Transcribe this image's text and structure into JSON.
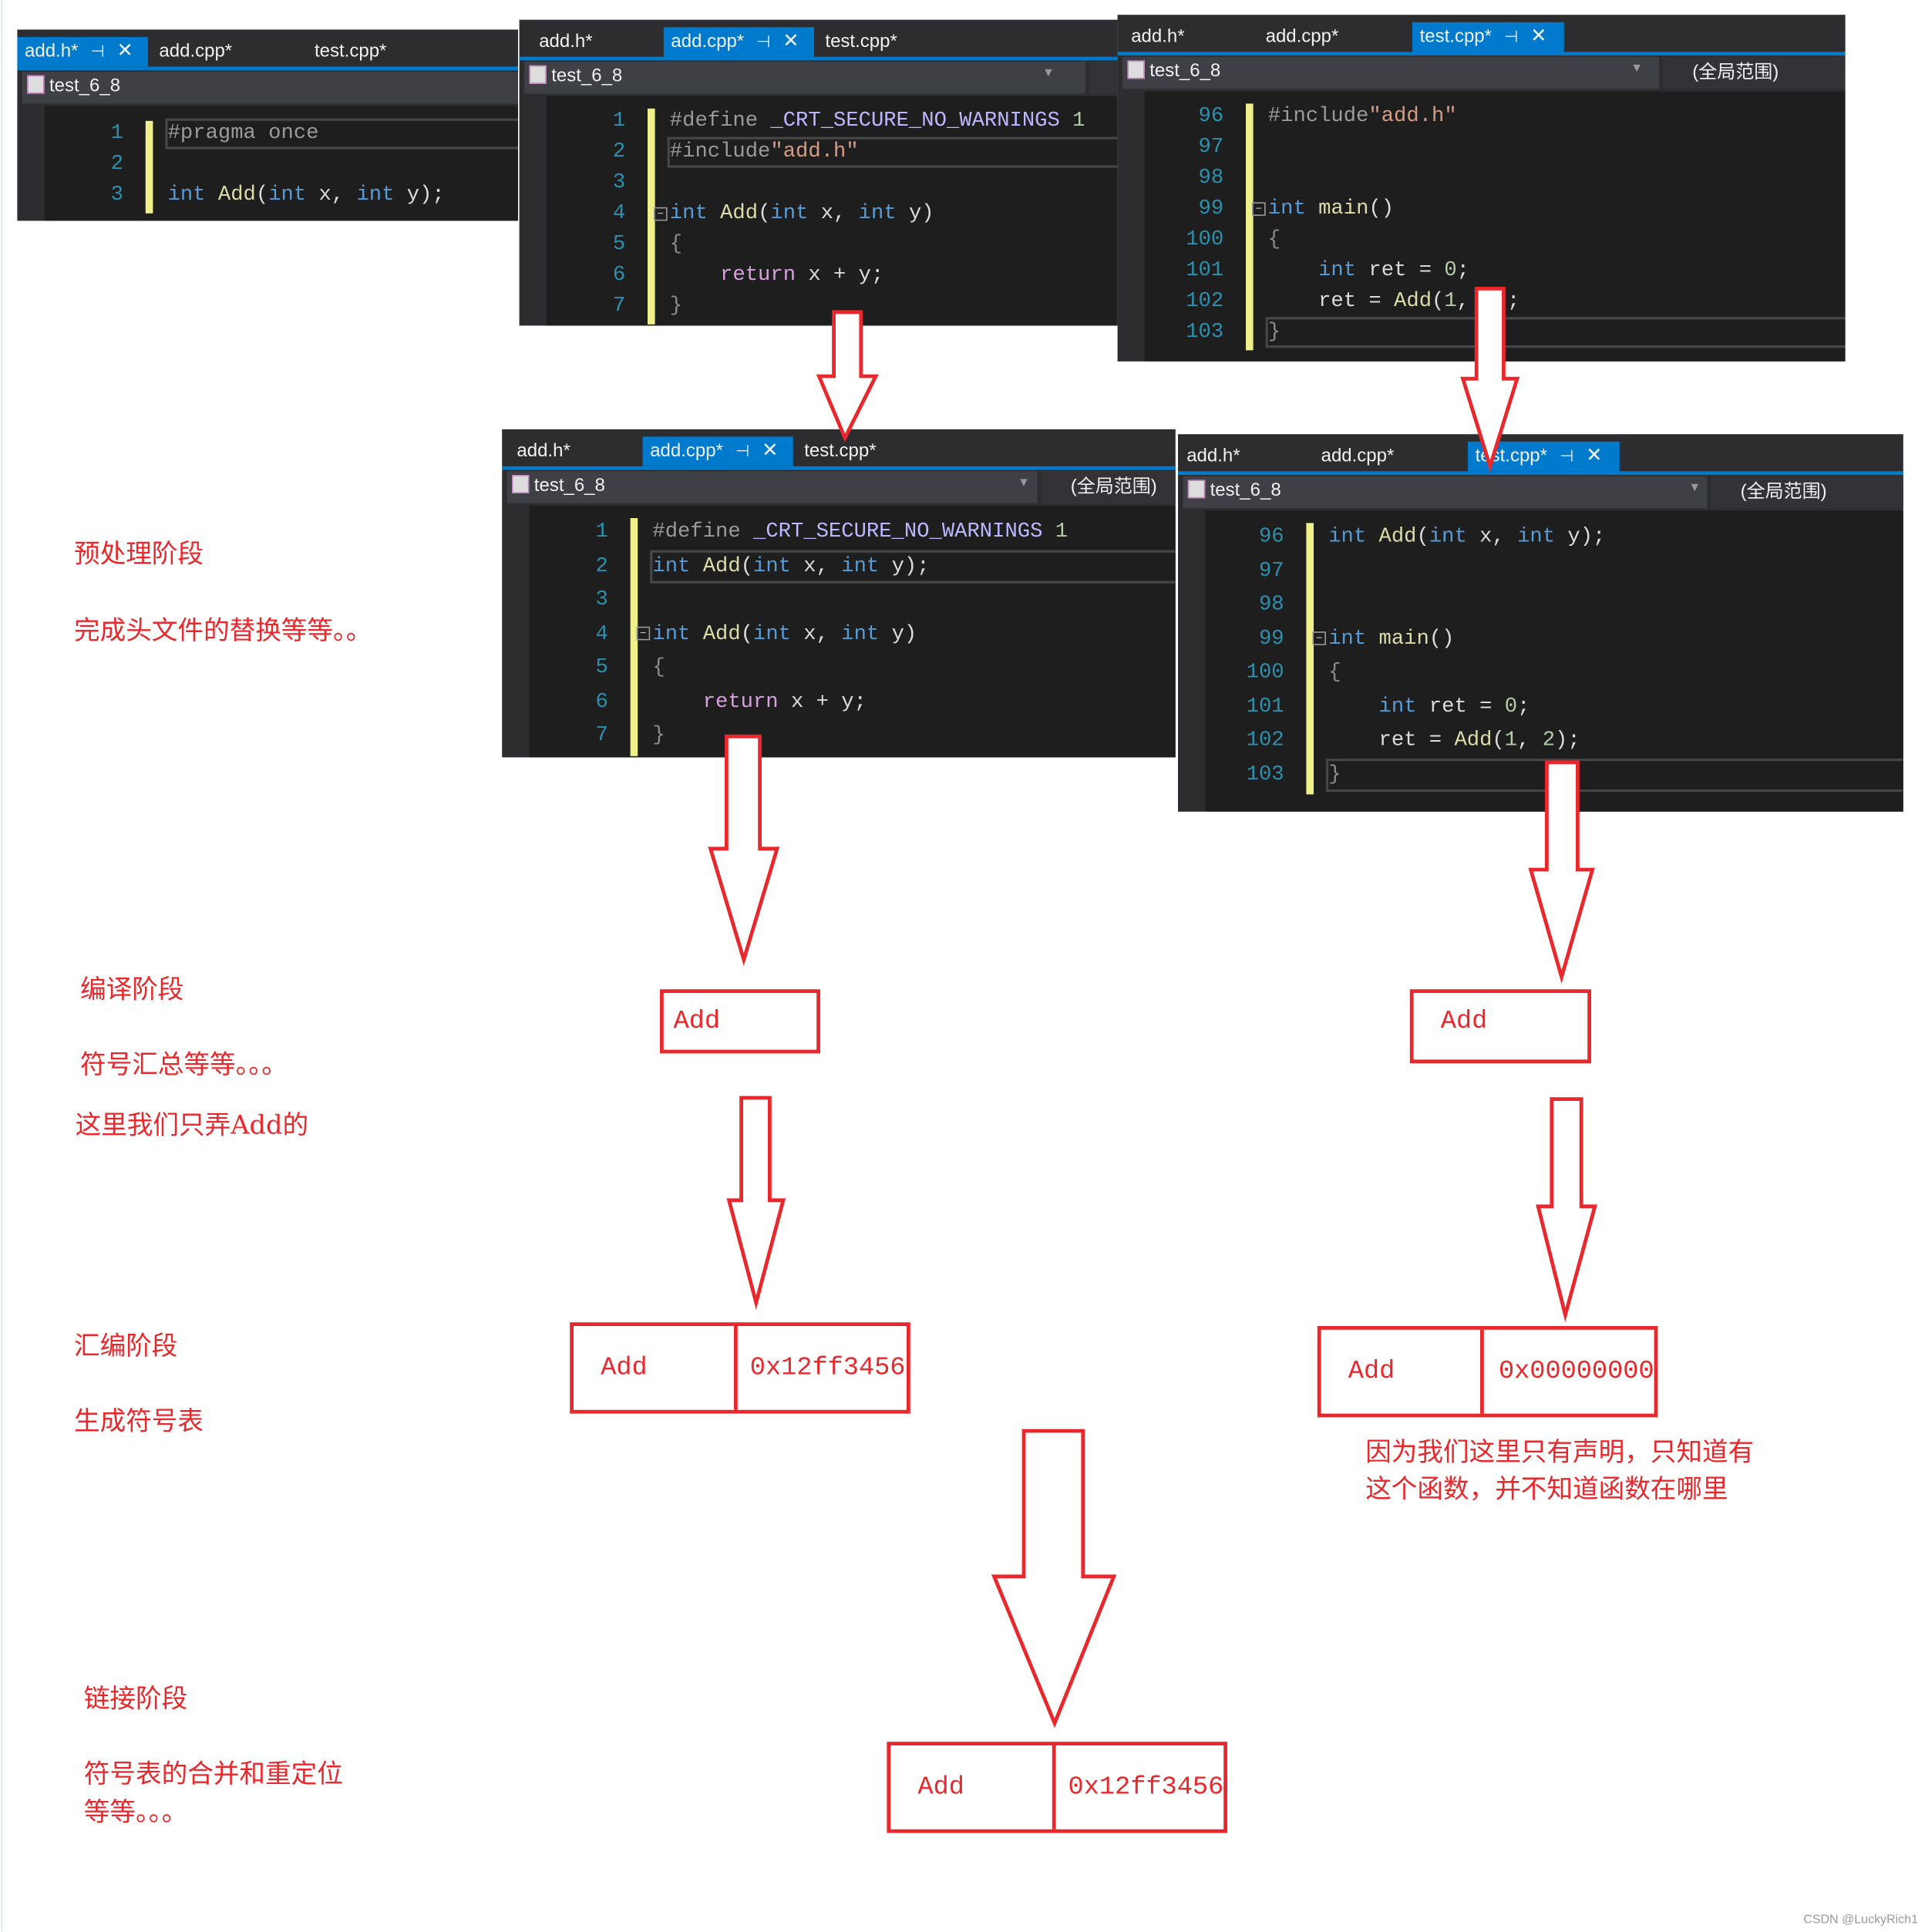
{
  "colors": {
    "accent": "#e8282c",
    "tab_active": "#007acc",
    "guide": "#eff08a"
  },
  "editors": [
    {
      "id": "p1",
      "tabs": [
        {
          "label": "add.h*",
          "active": true
        },
        {
          "label": "add.cpp*"
        },
        {
          "label": "test.cpp*"
        }
      ],
      "project": "test_6_8",
      "scope": "",
      "lines": [
        {
          "n": "1",
          "t": [
            [
              "#pragma once",
              "pre"
            ]
          ]
        },
        {
          "n": "2",
          "t": []
        },
        {
          "n": "3",
          "t": [
            [
              "int ",
              "kw"
            ],
            [
              "Add",
              "fn"
            ],
            [
              "(",
              "pl"
            ],
            [
              "int ",
              "kw"
            ],
            [
              "x, ",
              "pl"
            ],
            [
              "int ",
              "kw"
            ],
            [
              "y);",
              "pl"
            ]
          ]
        }
      ]
    },
    {
      "id": "p2",
      "tabs": [
        {
          "label": "add.h*"
        },
        {
          "label": "add.cpp*",
          "active": true
        },
        {
          "label": "test.cpp*"
        }
      ],
      "project": "test_6_8",
      "scope": "(全局范围)",
      "lines": [
        {
          "n": "1",
          "t": [
            [
              "#define ",
              "pre"
            ],
            [
              "_CRT_SECURE_NO_WARNINGS ",
              "mac"
            ],
            [
              "1",
              "num"
            ]
          ]
        },
        {
          "n": "2",
          "t": [
            [
              "#include",
              "pre"
            ],
            [
              "\"add.h\"",
              "str"
            ]
          ]
        },
        {
          "n": "3",
          "t": []
        },
        {
          "n": "4",
          "t": [
            [
              "int ",
              "kw"
            ],
            [
              "Add",
              "fn"
            ],
            [
              "(",
              "pl"
            ],
            [
              "int ",
              "kw"
            ],
            [
              "x, ",
              "pl"
            ],
            [
              "int ",
              "kw"
            ],
            [
              "y)",
              "pl"
            ]
          ]
        },
        {
          "n": "5",
          "t": [
            [
              "{",
              "br"
            ]
          ]
        },
        {
          "n": "6",
          "t": [
            [
              "    return ",
              "ctl"
            ],
            [
              "x + y;",
              "pl"
            ]
          ]
        },
        {
          "n": "7",
          "t": [
            [
              "}",
              "br"
            ]
          ]
        }
      ]
    },
    {
      "id": "p3",
      "tabs": [
        {
          "label": "add.h*"
        },
        {
          "label": "add.cpp*"
        },
        {
          "label": "test.cpp*",
          "active": true
        }
      ],
      "project": "test_6_8",
      "scope": "(全局范围)",
      "lines": [
        {
          "n": "96",
          "t": [
            [
              "#include",
              "pre"
            ],
            [
              "\"add.h\"",
              "str"
            ]
          ]
        },
        {
          "n": "97",
          "t": []
        },
        {
          "n": "98",
          "t": []
        },
        {
          "n": "99",
          "t": [
            [
              "int ",
              "kw"
            ],
            [
              "main",
              "fn"
            ],
            [
              "()",
              "pl"
            ]
          ]
        },
        {
          "n": "100",
          "t": [
            [
              "{",
              "br"
            ]
          ]
        },
        {
          "n": "101",
          "t": [
            [
              "    int ",
              "kw"
            ],
            [
              "ret ",
              "pl"
            ],
            [
              "= ",
              "pl"
            ],
            [
              "0",
              "num"
            ],
            [
              ";",
              "pl"
            ]
          ]
        },
        {
          "n": "102",
          "t": [
            [
              "    ret = ",
              "pl"
            ],
            [
              "Add",
              "fn"
            ],
            [
              "(",
              "pl"
            ],
            [
              "1",
              "num"
            ],
            [
              ", ",
              "pl"
            ],
            [
              "2",
              "num"
            ],
            [
              ");",
              "pl"
            ]
          ]
        },
        {
          "n": "103",
          "t": [
            [
              "}",
              "br"
            ]
          ]
        }
      ]
    },
    {
      "id": "p4",
      "tabs": [
        {
          "label": "add.h*"
        },
        {
          "label": "add.cpp*",
          "active": true
        },
        {
          "label": "test.cpp*"
        }
      ],
      "project": "test_6_8",
      "scope": "(全局范围)",
      "lines": [
        {
          "n": "1",
          "t": [
            [
              "#define ",
              "pre"
            ],
            [
              "_CRT_SECURE_NO_WARNINGS ",
              "mac"
            ],
            [
              "1",
              "num"
            ]
          ]
        },
        {
          "n": "2",
          "t": [
            [
              "int ",
              "kw"
            ],
            [
              "Add",
              "fn"
            ],
            [
              "(",
              "pl"
            ],
            [
              "int ",
              "kw"
            ],
            [
              "x, ",
              "pl"
            ],
            [
              "int ",
              "kw"
            ],
            [
              "y);",
              "pl"
            ]
          ]
        },
        {
          "n": "3",
          "t": []
        },
        {
          "n": "4",
          "t": [
            [
              "int ",
              "kw"
            ],
            [
              "Add",
              "fn"
            ],
            [
              "(",
              "pl"
            ],
            [
              "int ",
              "kw"
            ],
            [
              "x, ",
              "pl"
            ],
            [
              "int ",
              "kw"
            ],
            [
              "y)",
              "pl"
            ]
          ]
        },
        {
          "n": "5",
          "t": [
            [
              "{",
              "br"
            ]
          ]
        },
        {
          "n": "6",
          "t": [
            [
              "    return ",
              "ctl"
            ],
            [
              "x + y;",
              "pl"
            ]
          ]
        },
        {
          "n": "7",
          "t": [
            [
              "}",
              "br"
            ]
          ]
        }
      ]
    },
    {
      "id": "p5",
      "tabs": [
        {
          "label": "add.h*"
        },
        {
          "label": "add.cpp*"
        },
        {
          "label": "test.cpp*",
          "active": true
        }
      ],
      "project": "test_6_8",
      "scope": "(全局范围)",
      "lines": [
        {
          "n": "96",
          "t": [
            [
              "int ",
              "kw"
            ],
            [
              "Add",
              "fn"
            ],
            [
              "(",
              "pl"
            ],
            [
              "int ",
              "kw"
            ],
            [
              "x, ",
              "pl"
            ],
            [
              "int ",
              "kw"
            ],
            [
              "y);",
              "pl"
            ]
          ]
        },
        {
          "n": "97",
          "t": []
        },
        {
          "n": "98",
          "t": []
        },
        {
          "n": "99",
          "t": [
            [
              "int ",
              "kw"
            ],
            [
              "main",
              "fn"
            ],
            [
              "()",
              "pl"
            ]
          ]
        },
        {
          "n": "100",
          "t": [
            [
              "{",
              "br"
            ]
          ]
        },
        {
          "n": "101",
          "t": [
            [
              "    int ",
              "kw"
            ],
            [
              "ret ",
              "pl"
            ],
            [
              "= ",
              "pl"
            ],
            [
              "0",
              "num"
            ],
            [
              ";",
              "pl"
            ]
          ]
        },
        {
          "n": "102",
          "t": [
            [
              "    ret = ",
              "pl"
            ],
            [
              "Add",
              "fn"
            ],
            [
              "(",
              "pl"
            ],
            [
              "1",
              "num"
            ],
            [
              ", ",
              "pl"
            ],
            [
              "2",
              "num"
            ],
            [
              ");",
              "pl"
            ]
          ]
        },
        {
          "n": "103",
          "t": [
            [
              "}",
              "br"
            ]
          ]
        }
      ]
    }
  ],
  "labels": {
    "preprocess_title": "预处理阶段",
    "preprocess_desc": "完成头文件的替换等等。。",
    "compile_title": "编译阶段",
    "compile_desc": "符号汇总等等。。。",
    "compile_note": "这里我们只弄Add的",
    "assemble_title": "汇编阶段",
    "assemble_desc": "生成符号表",
    "link_title": "链接阶段",
    "link_desc1": "符号表的合并和重定位",
    "link_desc2": "等等。。。",
    "note1": "因为我们这里只有声明，只知道有",
    "note2": "这个函数，并不知道函数在哪里"
  },
  "boxes": {
    "compile_left": {
      "name": "Add"
    },
    "compile_right": {
      "name": "Add"
    },
    "asm_left": {
      "name": "Add",
      "addr": "0x12ff3456"
    },
    "asm_right": {
      "name": "Add",
      "addr": "0x00000000"
    },
    "link": {
      "name": "Add",
      "addr": "0x12ff3456"
    }
  },
  "watermark": "CSDN @LuckyRich1"
}
